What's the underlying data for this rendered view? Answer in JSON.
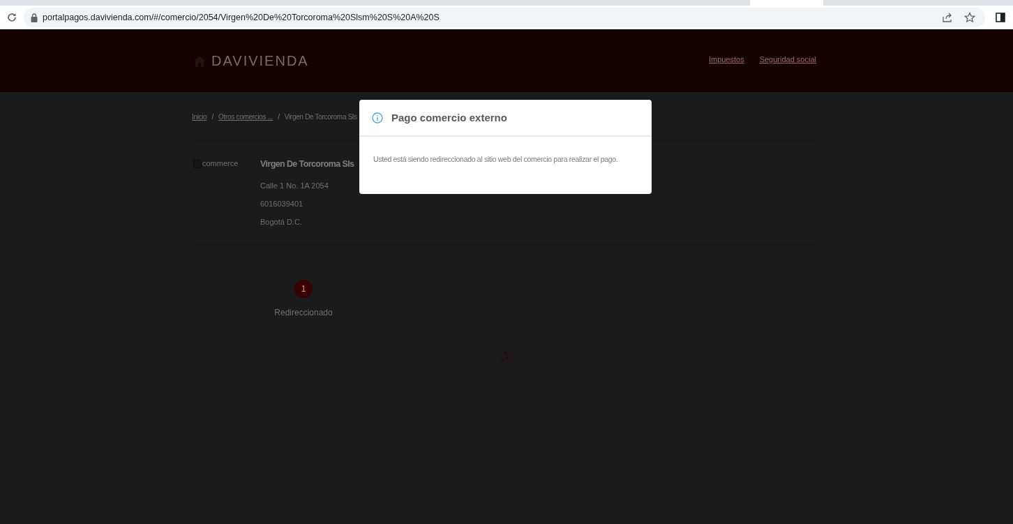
{
  "browser": {
    "url": "portalpagos.davivienda.com/#/comercio/2054/Virgen%20De%20Torcoroma%20Slsm%20S%20A%20S"
  },
  "header": {
    "logo": "DAVIVIENDA",
    "nav": [
      "Impuestos",
      "Seguridad social"
    ]
  },
  "breadcrumb": [
    {
      "kind": "link",
      "label": "Inicio"
    },
    {
      "kind": "separator",
      "label": "/"
    },
    {
      "kind": "link",
      "label": "Otros comercios ..."
    },
    {
      "kind": "separator",
      "label": "/"
    },
    {
      "kind": "current",
      "label": "Virgen De Torcoroma Sls"
    }
  ],
  "commerce": {
    "image_alt": "commerce",
    "name": "Virgen De Torcoroma Sls",
    "details": [
      "Calle 1 No. 1A 2054",
      "6016039401",
      "Bogotá D.C."
    ]
  },
  "steps": [
    {
      "number": "1",
      "label": "Redireccionado",
      "selected": true
    }
  ],
  "modal": {
    "title": "Pago comercio externo",
    "message": "Usted está siendo redireccionado al sitio web del comercio para realizar el pago."
  }
}
